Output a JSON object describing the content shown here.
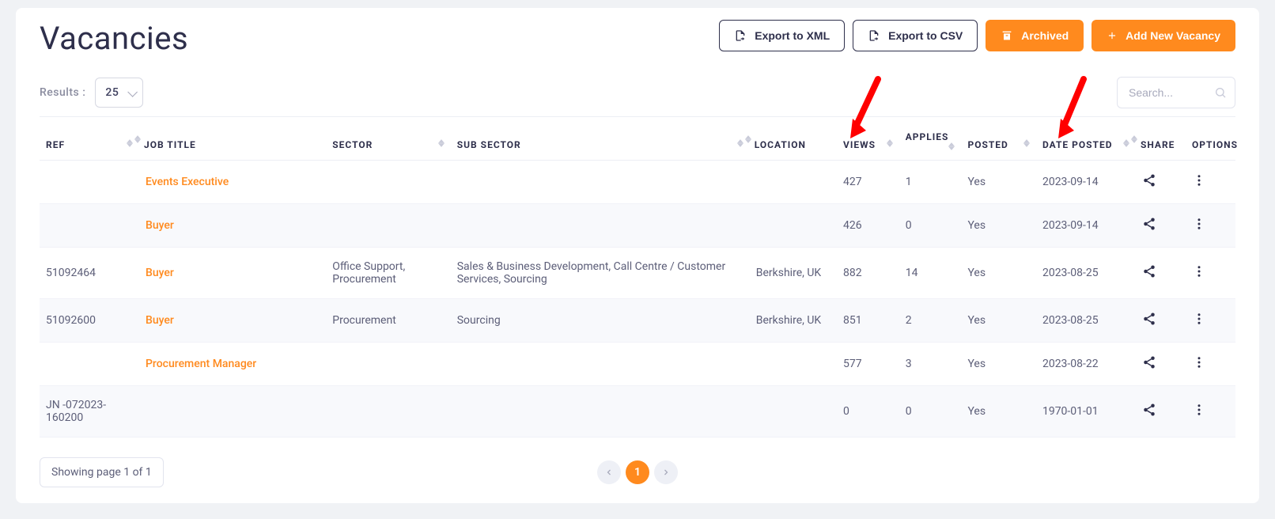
{
  "header": {
    "title": "Vacancies",
    "buttons": {
      "export_xml": "Export to XML",
      "export_csv": "Export to CSV",
      "archived": "Archived",
      "add_new": "Add New Vacancy"
    }
  },
  "controls": {
    "results_label": "Results :",
    "results_value": "25",
    "search_placeholder": "Search..."
  },
  "columns": {
    "ref": "REF",
    "job_title": "JOB TITLE",
    "sector": "SECTOR",
    "sub_sector": "SUB SECTOR",
    "location": "LOCATION",
    "views": "VIEWS",
    "applies": "APPLIES",
    "posted": "POSTED",
    "date_posted": "DATE POSTED",
    "share": "SHARE",
    "options": "OPTIONS"
  },
  "rows": [
    {
      "ref": "",
      "title": "Events Executive",
      "sector": "",
      "sub": "",
      "loc": "",
      "views": "427",
      "applies": "1",
      "posted": "Yes",
      "date": "2023-09-14"
    },
    {
      "ref": "",
      "title": "Buyer",
      "sector": "",
      "sub": "",
      "loc": "",
      "views": "426",
      "applies": "0",
      "posted": "Yes",
      "date": "2023-09-14"
    },
    {
      "ref": "51092464",
      "title": "Buyer",
      "sector": "Office Support, Procurement",
      "sub": "Sales & Business Development, Call Centre / Customer Services, Sourcing",
      "loc": "Berkshire, UK",
      "views": "882",
      "applies": "14",
      "posted": "Yes",
      "date": "2023-08-25"
    },
    {
      "ref": "51092600",
      "title": "Buyer",
      "sector": "Procurement",
      "sub": "Sourcing",
      "loc": "Berkshire, UK",
      "views": "851",
      "applies": "2",
      "posted": "Yes",
      "date": "2023-08-25"
    },
    {
      "ref": "",
      "title": "Procurement Manager",
      "sector": "",
      "sub": "",
      "loc": "",
      "views": "577",
      "applies": "3",
      "posted": "Yes",
      "date": "2023-08-22"
    },
    {
      "ref": "JN -072023-160200",
      "title": "",
      "sector": "",
      "sub": "",
      "loc": "",
      "views": "0",
      "applies": "0",
      "posted": "Yes",
      "date": "1970-01-01"
    }
  ],
  "footer": {
    "info": "Showing page 1 of 1",
    "current_page": "1"
  }
}
